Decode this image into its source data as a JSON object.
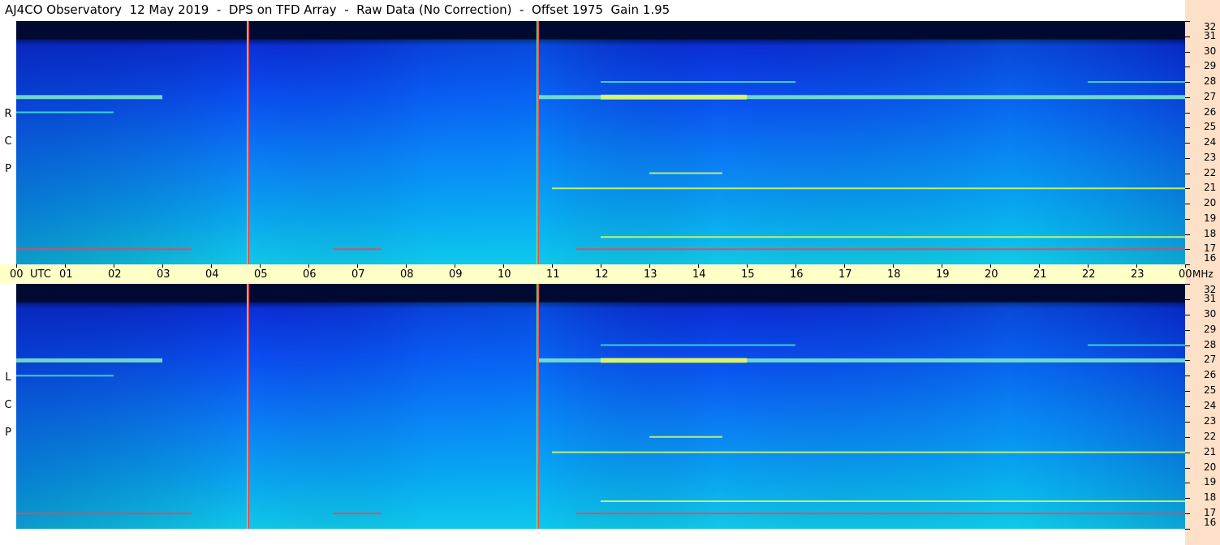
{
  "title": "AJ4CO Observatory  12 May 2019  -  DPS on TFD Array  -  Raw Data (No Correction)  -  Offset 1975  Gain 1.95",
  "colors": {
    "background": "#ffffff",
    "time_bar": "#ffffc8",
    "freq_strip": "#fde0c8",
    "noise_floor": "#1a5cff",
    "band_edge": "#000a3a"
  },
  "time_axis": {
    "labels": [
      "00",
      "01",
      "02",
      "03",
      "04",
      "05",
      "06",
      "07",
      "08",
      "09",
      "10",
      "11",
      "12",
      "13",
      "14",
      "15",
      "16",
      "17",
      "18",
      "19",
      "20",
      "21",
      "22",
      "23",
      "00"
    ],
    "unit_label": "UTC",
    "freq_unit_label": "MHz"
  },
  "panels": [
    {
      "id": "rcp",
      "label_letters": [
        "R",
        "C",
        "P"
      ]
    },
    {
      "id": "lcp",
      "label_letters": [
        "L",
        "C",
        "P"
      ]
    }
  ],
  "chart_data": {
    "type": "heatmap",
    "title": "AJ4CO Observatory  12 May 2019  -  DPS on TFD Array  -  Raw Data (No Correction)  -  Offset 1975  Gain 1.95",
    "x": {
      "label": "UTC",
      "range": [
        0,
        24
      ],
      "ticks": [
        0,
        1,
        2,
        3,
        4,
        5,
        6,
        7,
        8,
        9,
        10,
        11,
        12,
        13,
        14,
        15,
        16,
        17,
        18,
        19,
        20,
        21,
        22,
        23,
        24
      ]
    },
    "y": {
      "label": "MHz",
      "range": [
        16,
        32
      ],
      "ticks": [
        16,
        17,
        18,
        19,
        20,
        21,
        22,
        23,
        24,
        25,
        26,
        27,
        28,
        29,
        30,
        31,
        32
      ]
    },
    "panels": [
      "RCP",
      "LCP"
    ],
    "markers_utc": [
      4.75,
      10.7
    ],
    "features": [
      {
        "name": "strong band",
        "freq_mhz": 27.0,
        "utc_ranges": [
          [
            0,
            3
          ],
          [
            10.7,
            24
          ]
        ],
        "peak_utc": [
          12,
          15
        ]
      },
      {
        "name": "carrier",
        "freq_mhz": 17.0,
        "utc_ranges": [
          [
            0,
            3.6
          ],
          [
            6.5,
            7.5
          ],
          [
            11.5,
            24
          ]
        ]
      },
      {
        "name": "carrier",
        "freq_mhz": 17.8,
        "utc_ranges": [
          [
            12,
            24
          ]
        ]
      },
      {
        "name": "carrier",
        "freq_mhz": 21.0,
        "utc_ranges": [
          [
            11,
            24
          ]
        ]
      },
      {
        "name": "carrier",
        "freq_mhz": 22.0,
        "utc_ranges": [
          [
            13,
            14.5
          ]
        ]
      },
      {
        "name": "weak band",
        "freq_mhz": 28.0,
        "utc_ranges": [
          [
            12,
            16
          ],
          [
            22,
            24
          ]
        ]
      },
      {
        "name": "weak band",
        "freq_mhz": 26.0,
        "utc_ranges": [
          [
            0,
            2
          ]
        ]
      }
    ]
  }
}
